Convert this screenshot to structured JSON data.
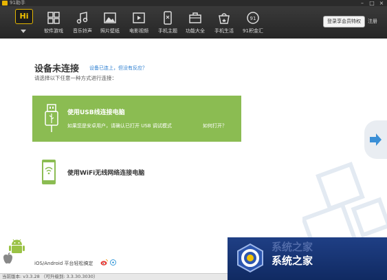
{
  "window": {
    "title": "91助手",
    "controls": {
      "minimize": "–",
      "maximize": "□",
      "close": "×"
    }
  },
  "toolbar": {
    "logo_text": "Hi",
    "items": [
      {
        "label": "软件游戏",
        "icon": "apps-grid-icon"
      },
      {
        "label": "音乐铃声",
        "icon": "music-note-icon"
      },
      {
        "label": "照片壁纸",
        "icon": "image-icon"
      },
      {
        "label": "电影视频",
        "icon": "video-play-icon"
      },
      {
        "label": "手机主题",
        "icon": "phone-theme-icon"
      },
      {
        "label": "功能大全",
        "icon": "toolbox-icon"
      },
      {
        "label": "手机生活",
        "icon": "shopping-bag-icon"
      },
      {
        "label": "91积金汇",
        "icon": "gold-coin-icon"
      }
    ],
    "login_button": "登录享会员特权",
    "register_link": "注册"
  },
  "main": {
    "title": "设备未连接",
    "help_link": "设备已连上，但没有反应？",
    "subtitle": "请选择以下任意一种方式进行连接：",
    "usb": {
      "title": "使用USB线连接电脑",
      "description": "如果您是安卓用户，请确认已打开 USB 调试模式",
      "link": "如何打开？"
    },
    "wifi": {
      "title": "使用WiFi无线网络连接电脑"
    },
    "footer_text": "iOS/Android 平台轻松搞定"
  },
  "statusbar": {
    "version": "当前版本: v3.3.28 （可升级到: 3.3.30.3030）"
  },
  "watermark": {
    "text": "系统之家",
    "ghost_text": "系统之家"
  },
  "colors": {
    "usb_card": "#8bbc52",
    "toolbar_bg": "#2f2f2f",
    "logo_accent": "#e6b800",
    "link_blue": "#2d7fd1",
    "watermark_bg": "#1a3574"
  }
}
